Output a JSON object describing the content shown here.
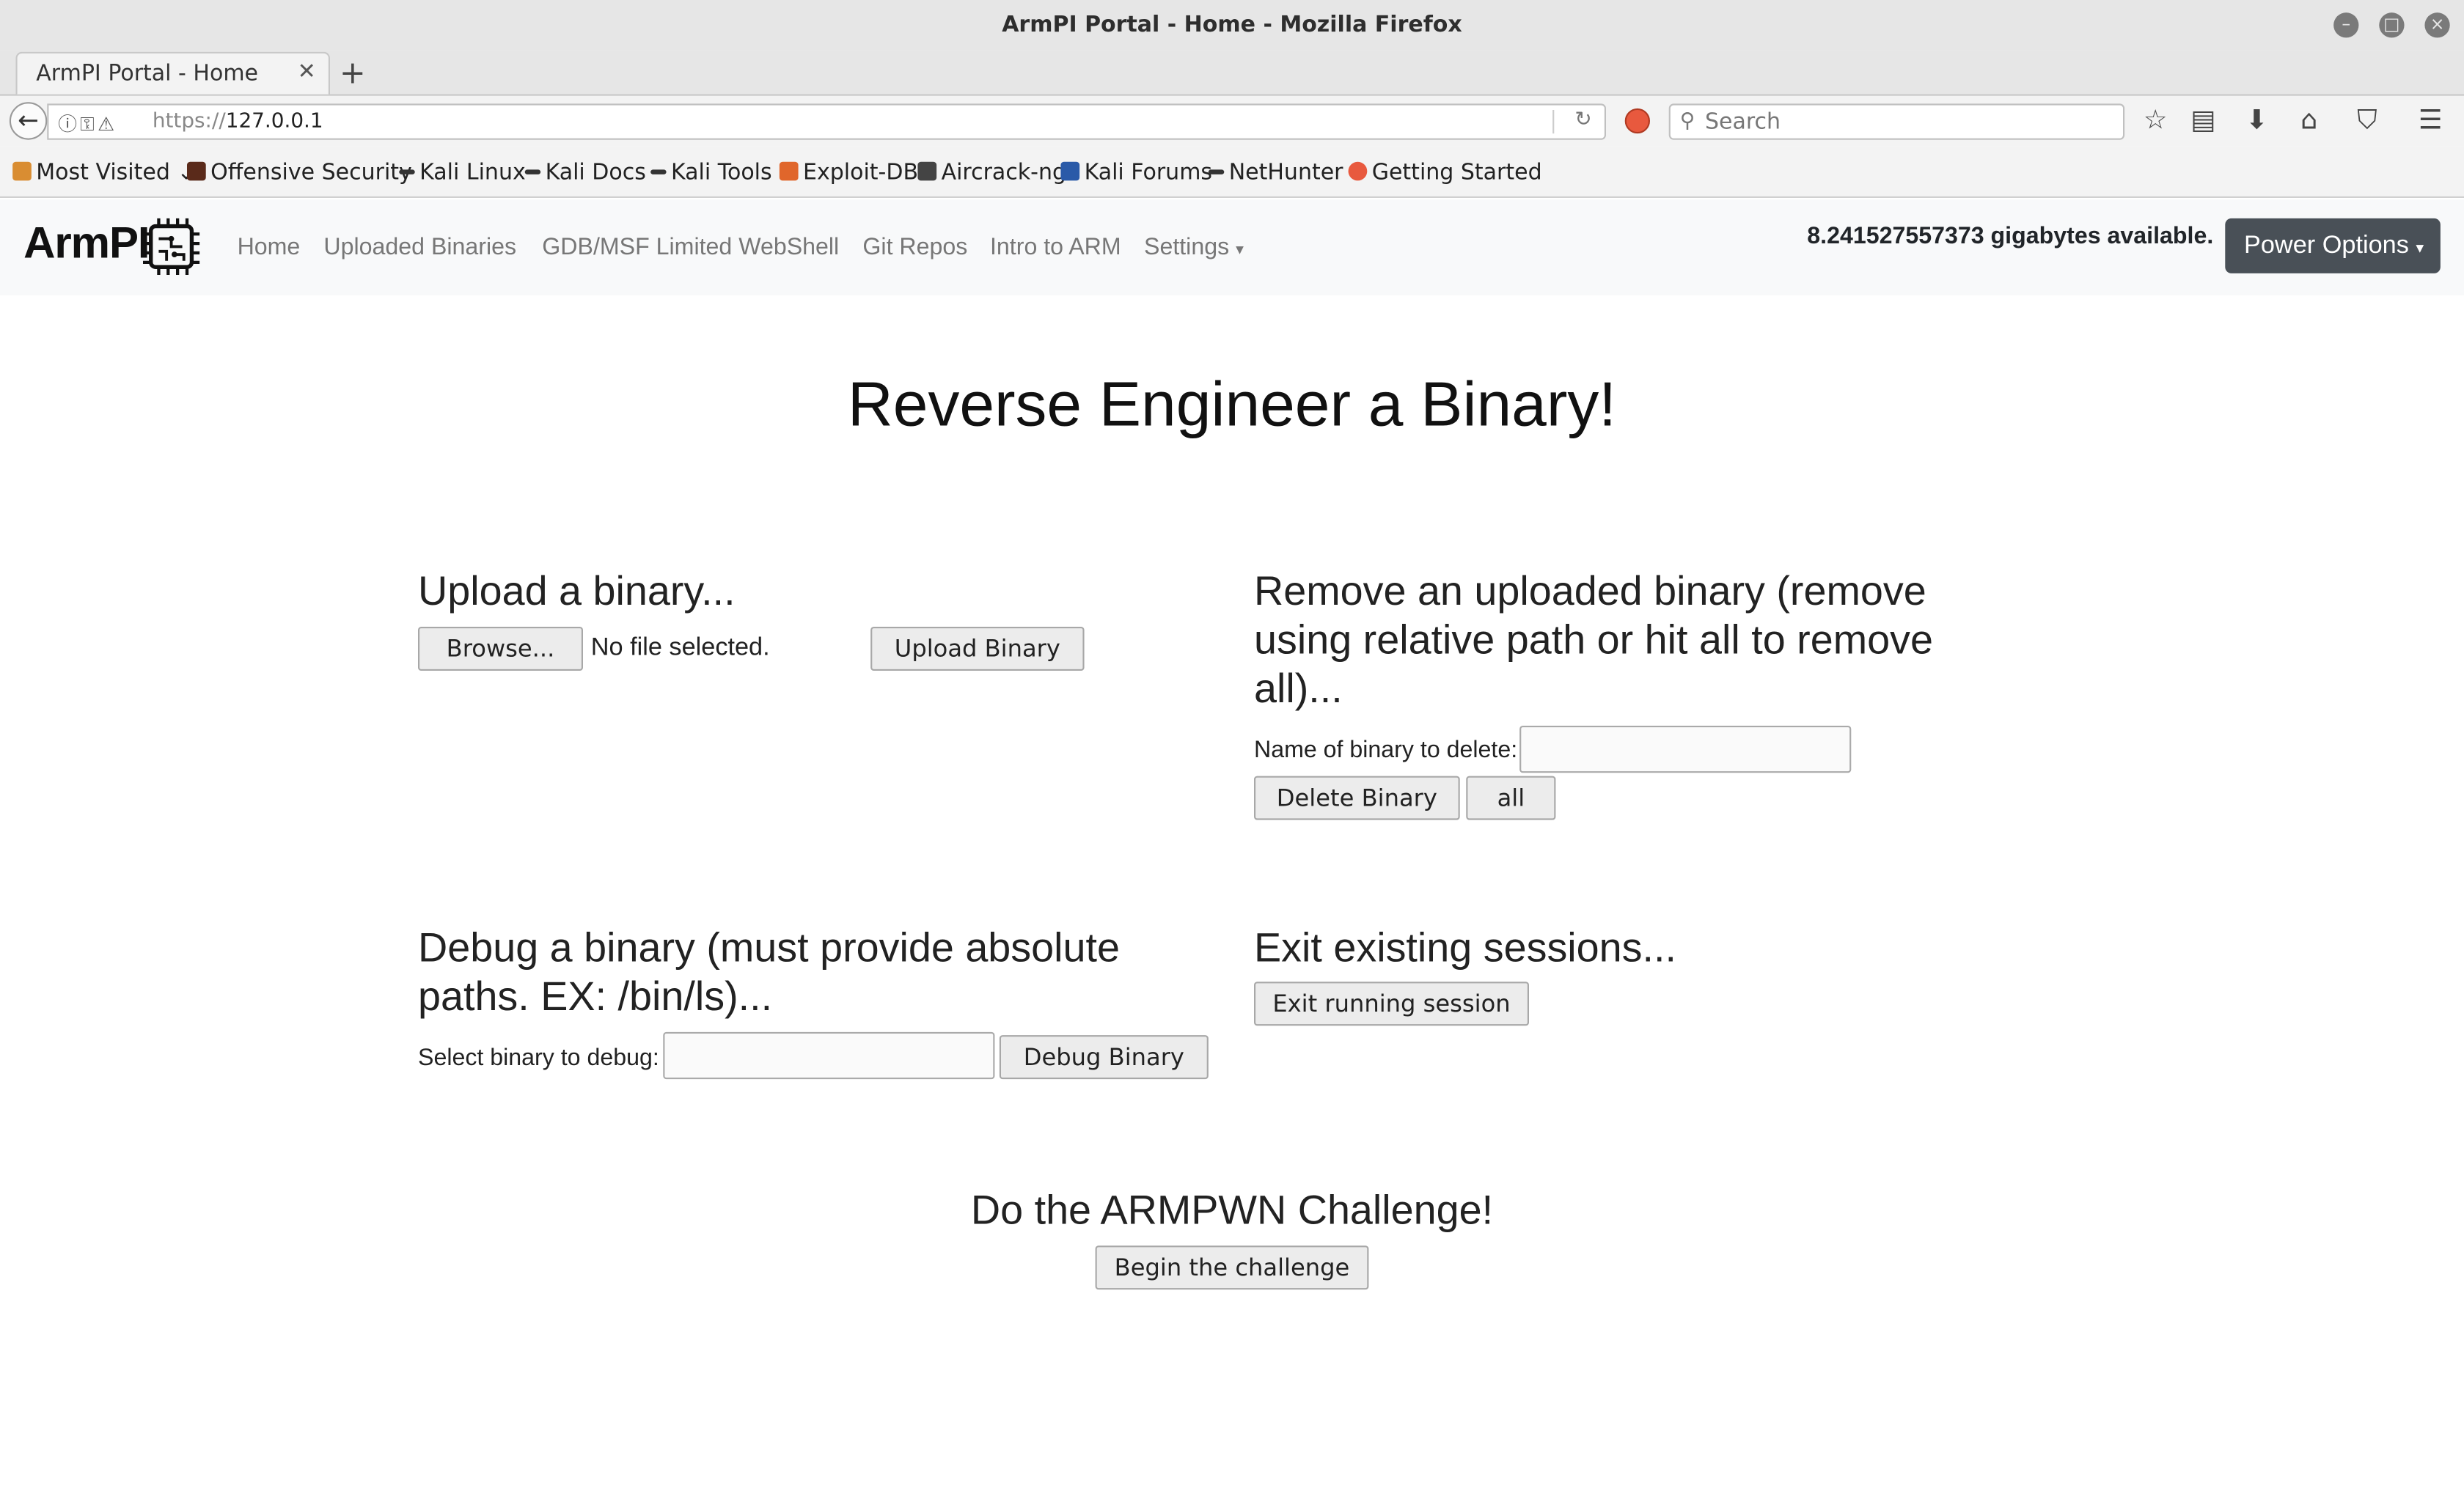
{
  "window": {
    "title": "ArmPI Portal - Home - Mozilla Firefox"
  },
  "browser": {
    "tab_title": "ArmPI Portal - Home",
    "url_scheme": "https://",
    "url_host": "127.0.0.1",
    "search_placeholder": "Search",
    "bookmarks": [
      {
        "label": "Most Visited",
        "icon_color": "#d98d32"
      },
      {
        "label": "Offensive Security",
        "icon_color": "#5a2a1a"
      },
      {
        "label": "Kali Linux",
        "icon_color": "#333333"
      },
      {
        "label": "Kali Docs",
        "icon_color": "#333333"
      },
      {
        "label": "Kali Tools",
        "icon_color": "#333333"
      },
      {
        "label": "Exploit-DB",
        "icon_color": "#e0662b"
      },
      {
        "label": "Aircrack-ng",
        "icon_color": "#444444"
      },
      {
        "label": "Kali Forums",
        "icon_color": "#2a5aa8"
      },
      {
        "label": "NetHunter",
        "icon_color": "#333333"
      },
      {
        "label": "Getting Started",
        "icon_color": "#e8593e"
      }
    ]
  },
  "site": {
    "brand": "ArmPI",
    "nav": {
      "home": "Home",
      "uploaded_binaries": "Uploaded Binaries",
      "gdb_shell": "GDB/MSF Limited WebShell",
      "git_repos": "Git Repos",
      "intro_arm": "Intro to ARM",
      "settings": "Settings"
    },
    "free_space": "8.241527557373 gigabytes available.",
    "power_options": "Power Options"
  },
  "main": {
    "title": "Reverse Engineer a Binary!",
    "upload": {
      "heading": "Upload a binary...",
      "browse_label": "Browse...",
      "file_status": "No file selected.",
      "upload_button": "Upload Binary"
    },
    "remove": {
      "heading_line1": "Remove an uploaded binary (remove",
      "heading_line2": "using relative path or hit all to remove",
      "heading_line3": "all)...",
      "name_label": "Name of binary to delete:",
      "name_value": "",
      "delete_button": "Delete Binary",
      "all_button": "all"
    },
    "debug": {
      "heading_line1": "Debug a binary (must provide absolute",
      "heading_line2": "paths. EX: /bin/ls)...",
      "select_label": "Select binary to debug:",
      "select_value": "",
      "debug_button": "Debug Binary"
    },
    "exit": {
      "heading": "Exit existing sessions...",
      "exit_button": "Exit running session"
    },
    "challenge": {
      "heading": "Do the ARMPWN Challenge!",
      "begin_button": "Begin the challenge"
    }
  }
}
